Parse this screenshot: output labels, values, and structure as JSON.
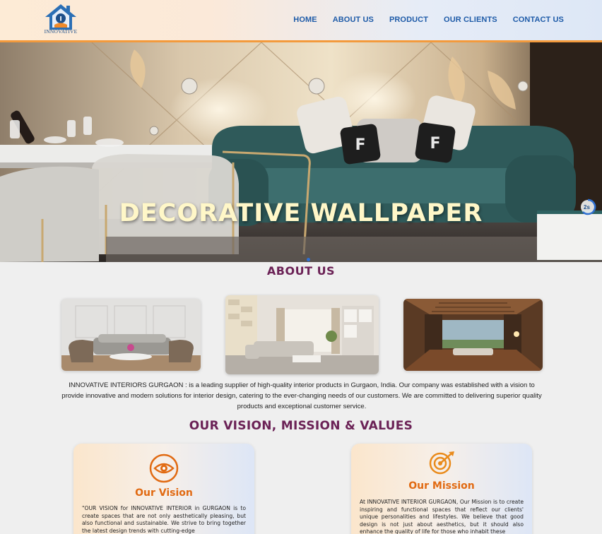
{
  "header": {
    "logo_text": "INNOVATIVE",
    "nav": [
      "HOME",
      "ABOUT US",
      "PRODUCT",
      "OUR CLIENTS",
      "CONTACT US"
    ]
  },
  "hero": {
    "title": "DECORATIVE WALLPAPER",
    "timer": "2s"
  },
  "about": {
    "title": "ABOUT US",
    "text": "INNOVATIVE INTERIORS GURGAON : is a leading supplier of high-quality interior products in Gurgaon, India. Our company was established with a vision to provide innovative and modern solutions for interior design, catering to the ever-changing needs of our customers. We are committed to delivering superior quality products and exceptional customer service."
  },
  "vmv": {
    "title": "OUR VISION, MISSION & VALUES",
    "vision_title": "Our Vision",
    "vision_text": "\"OUR VISION for INNOVATIVE INTERIOR in GURGAON is to create spaces that are not only aesthetically pleasing, but also functional and sustainable. We strive to bring together the latest design trends with cutting-edge",
    "mission_title": "Our Mission",
    "mission_text": "At INNOVATIVE INTERIOR GURGAON, Our Mission is to create inspiring and functional spaces that reflect our clients' unique personalities and lifestyles. We believe that good design is not just about aesthetics, but it should also enhance the quality of life for those who inhabit these"
  },
  "colors": {
    "nav": "#1e5ba8",
    "heading": "#6b2256",
    "accent": "#e16a12"
  }
}
